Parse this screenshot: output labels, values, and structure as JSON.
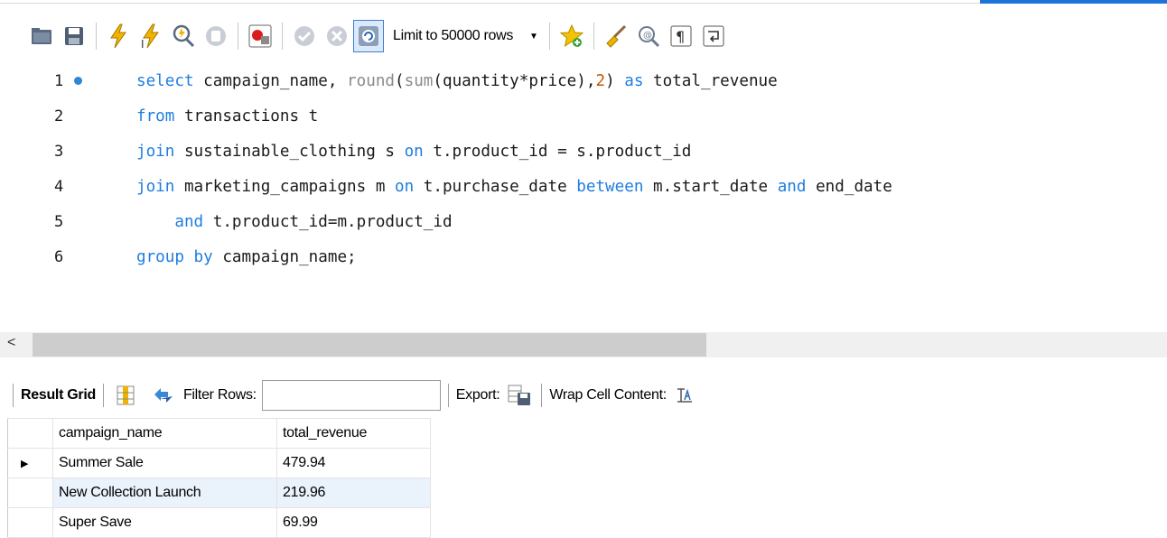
{
  "toolbar": {
    "icons": [
      "open-folder-icon",
      "save-icon",
      "execute-icon",
      "execute-current-icon",
      "explain-icon",
      "stop-icon",
      "toggle-error-icon",
      "commit-icon",
      "rollback-icon",
      "autocommit-icon",
      "beautify-icon",
      "find-icon",
      "invisible-chars-icon",
      "wrap-icon"
    ],
    "limit_label": "Limit to 50000 rows"
  },
  "editor": {
    "lines": [
      {
        "num": "1",
        "has_dot": true
      },
      {
        "num": "2"
      },
      {
        "num": "3"
      },
      {
        "num": "4"
      },
      {
        "num": "5"
      },
      {
        "num": "6"
      }
    ],
    "tokens": {
      "l1_select": "select",
      "l1_a": " campaign_name, ",
      "l1_round": "round",
      "l1_b": "(",
      "l1_sum": "sum",
      "l1_c": "(quantity*price),",
      "l1_two": "2",
      "l1_d": ") ",
      "l1_as": "as",
      "l1_e": " total_revenue",
      "l2_from": "from",
      "l2_a": " transactions t",
      "l3_join": "join",
      "l3_a": " sustainable_clothing s ",
      "l3_on": "on",
      "l3_b": " t.product_id = s.product_id",
      "l4_join": "join",
      "l4_a": " marketing_campaigns m ",
      "l4_on": "on",
      "l4_b": " t.purchase_date ",
      "l4_between": "between",
      "l4_c": " m.start_date ",
      "l4_and": "and",
      "l4_d": " end_date",
      "l5_indent": "    ",
      "l5_and": "and",
      "l5_a": " t.product_id=m.product_id",
      "l6_group": "group by",
      "l6_a": " campaign_name;"
    },
    "colors": {
      "keyword": "#1f7ee0",
      "function": "#8a8a8a",
      "number": "#c05800"
    }
  },
  "result_bar": {
    "grid_label": "Result Grid",
    "filter_label": "Filter Rows:",
    "filter_value": "",
    "export_label": "Export:",
    "wrap_label": "Wrap Cell Content:"
  },
  "grid": {
    "columns": [
      "campaign_name",
      "total_revenue"
    ],
    "rows": [
      {
        "campaign_name": "Summer Sale",
        "total_revenue": "479.94",
        "selected": true
      },
      {
        "campaign_name": "New Collection Launch",
        "total_revenue": "219.96"
      },
      {
        "campaign_name": "Super Save",
        "total_revenue": "69.99"
      }
    ]
  }
}
